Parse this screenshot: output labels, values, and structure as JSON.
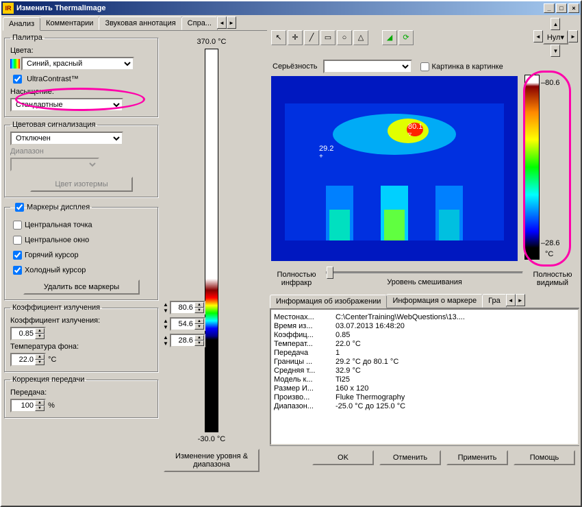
{
  "window": {
    "title": "Изменить ThermalImage",
    "tabs": [
      "Анализ",
      "Комментарии",
      "Звуковая аннотация",
      "Спра..."
    ]
  },
  "palette": {
    "legend": "Палитра",
    "colors_label": "Цвета:",
    "colors_value": "Синий, красный",
    "ultra_label": "UltraContrast™",
    "saturation_label": "Насыщение:",
    "saturation_value": "Стандартные"
  },
  "colorsig": {
    "legend": "Цветовая сигнализация",
    "value": "Отключен",
    "range_label": "Диапазон",
    "iso_btn": "Цвет изотермы"
  },
  "markers": {
    "legend": "Маркеры дисплея",
    "center_point": "Центральная точка",
    "center_window": "Центральное окно",
    "hot_cursor": "Горячий курсор",
    "cold_cursor": "Холодный курсор",
    "delete_btn": "Удалить все маркеры"
  },
  "emissivity": {
    "legend": "Коэффициент излучения",
    "coef_label": "Коэффициент излучения:",
    "coef_value": "0.85",
    "bg_temp_label": "Температура фона:",
    "bg_temp_value": "22.0",
    "bg_temp_unit": "°C"
  },
  "transmission": {
    "legend": "Коррекция передачи",
    "label": "Передача:",
    "value": "100",
    "unit": "%"
  },
  "scale": {
    "max": "370.0 °C",
    "min": "-30.0 °C",
    "v1": "80.6",
    "v2": "54.6",
    "v3": "28.6",
    "change_btn": "Изменение уровня & диапазона"
  },
  "right_toolbar": {
    "severity_label": "Серьёзность",
    "pip_label": "Картинка в картинке",
    "zoom": "Нул"
  },
  "thermal_overlay": {
    "hot": "80.1",
    "cold": "29.2"
  },
  "right_scale": {
    "max": "80.6",
    "min": "28.6",
    "unit": "°C"
  },
  "blend": {
    "left": "Полностью инфракр",
    "label": "Уровень смешивания",
    "right": "Полностью видимый"
  },
  "info_tabs": [
    "Информация об изображении",
    "Информация о маркере",
    "Гра"
  ],
  "info": [
    {
      "k": "Местонах...",
      "v": "C:\\CenterTraining\\WebQuestions\\13...."
    },
    {
      "k": "Время из...",
      "v": "03.07.2013 16:48:20"
    },
    {
      "k": "Коэффиц...",
      "v": "0.85"
    },
    {
      "k": "Температ...",
      "v": "22.0 °C"
    },
    {
      "k": "Передача",
      "v": "1"
    },
    {
      "k": "Границы ...",
      "v": "29.2 °C до 80.1 °C"
    },
    {
      "k": "Средняя т...",
      "v": "32.9 °C"
    },
    {
      "k": "Модель к...",
      "v": "Ti25"
    },
    {
      "k": "Размер И...",
      "v": "160 x 120"
    },
    {
      "k": "Произво...",
      "v": "Fluke Thermography"
    },
    {
      "k": "Диапазон...",
      "v": "-25.0 °C до 125.0 °C"
    }
  ],
  "buttons": {
    "ok": "OK",
    "cancel": "Отменить",
    "apply": "Применить",
    "help": "Помощь"
  }
}
